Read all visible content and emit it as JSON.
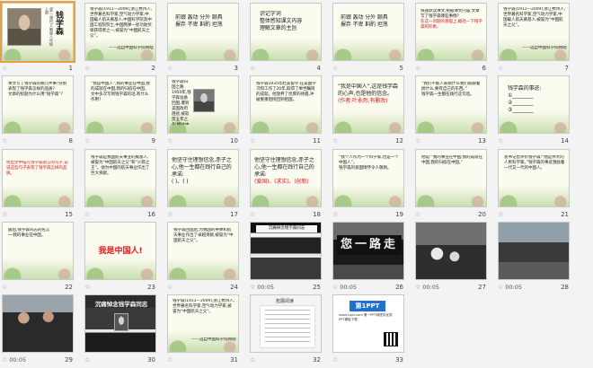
{
  "window": {
    "title": "Slide Sorter"
  },
  "slides": [
    {
      "num": "1",
      "kind": "title",
      "title": "钱学森",
      "subtitle": "(第一课时)人教版八年级上册",
      "star": "☆"
    },
    {
      "num": "2",
      "kind": "text",
      "lines": [
        "钱学森(1911—2009),浙江杭州人,世界著名科学家,空气动力学家,中国载人航天奠基人,中国科学院及中国工程院院士,中国两弹一星功勋奖章获得者之一,被誉为“中国航天之父”。"
      ],
      "footer": "——选自中国科学院网站",
      "star": "☆"
    },
    {
      "num": "3",
      "kind": "words",
      "lines": [
        "前辍  轰动  分外  颇具",
        "摒弃  不卑  斟酌  坦荡"
      ],
      "star": "☆"
    },
    {
      "num": "4",
      "kind": "text2",
      "lines": [
        "识记字词",
        "整体感知课文内容",
        "理解文章的主旨"
      ],
      "star": "☆"
    },
    {
      "num": "5",
      "kind": "words",
      "lines": [
        "前辍  轰动  分外  颇具",
        "摒弃  不卑  斟酌  坦荡"
      ],
      "star": "☆"
    },
    {
      "num": "6",
      "kind": "question",
      "lines": [
        "快速默读课文,把握课文内容,文章写了钱学森哪些事情?",
        "在这一问题的基础上,概括一下钱学森的形象。"
      ],
      "star": "☆"
    },
    {
      "num": "7",
      "kind": "text",
      "lines": [
        "钱学森(1911—2009),浙江杭州人,世界著名科学家,空气动力学家,中国载人航天奠基人,被誉为“中国航天之父”。"
      ],
      "footer": "——选自中国科学院网站",
      "star": "☆"
    },
    {
      "num": "8",
      "kind": "plain",
      "lines": [
        "本文写了钱学森的哪几件事?分别表现了钱学森怎样的品质?",
        "文章的标题为什么用“钱学森”?"
      ],
      "star": "☆"
    },
    {
      "num": "9",
      "kind": "plain",
      "lines": [
        "“我是中国人”,我的事业在中国,我的成就在中国,我的归宿在中国。",
        "文中多次写到钱学森的话,有什么作用?"
      ],
      "star": "☆"
    },
    {
      "num": "10",
      "kind": "portrait",
      "lines": [
        "钱学森归国之路",
        "1950年,钱学森准备回国,遭到美国政府阻挠,被软禁五年之久,经过中国政府的交涉,1955年终于回到祖国。"
      ],
      "star": "☆"
    },
    {
      "num": "11",
      "kind": "plain",
      "lines": [
        "钱学森1935年赴美留学,在美国学习和工作了20年,取得了举世瞩目的成就。他放弃了优厚的待遇,冲破重重阻挠回到祖国。"
      ],
      "star": "☆"
    },
    {
      "num": "12",
      "kind": "quote",
      "lines": [
        "“我是中国人”,这是钱学森的心声,也是他的信念。",
        "(作者:叶永烈,有删改)"
      ],
      "star": "☆"
    },
    {
      "num": "13",
      "kind": "plain",
      "lines": [
        "“我们不能人家搞什么我们就跟着搞什么,要有自己的东西。”",
        "钱学森一生都在践行这句话。"
      ],
      "star": "☆"
    },
    {
      "num": "14",
      "kind": "fill",
      "lines": [
        "钱学森的事迹:",
        "①________",
        "②________",
        "③________"
      ],
      "star": "☆"
    },
    {
      "num": "15",
      "kind": "redtext",
      "lines": [
        "找出文中描写钱学森语言的句子,说说这些句子表现了钱学森怎样的品质。"
      ],
      "star": "☆"
    },
    {
      "num": "16",
      "kind": "plain",
      "lines": [
        "钱学森是我国航天事业的奠基人,被誉为“中国航天之父”和“火箭之王”。他为中国的航天事业作出了巨大贡献。"
      ],
      "star": "☆"
    },
    {
      "num": "17",
      "kind": "fill2",
      "lines": [
        "他坚守住理想信念,赤子之心,他一生都在践行自己的承诺:",
        "(  )、(  )"
      ],
      "star": "☆"
    },
    {
      "num": "18",
      "kind": "fill3",
      "lines": [
        "他坚守住理想信念,赤子之心,他一生都在践行自己的承诺:",
        "(爱国)、(求实)、(创新)"
      ],
      "star": "☆"
    },
    {
      "num": "19",
      "kind": "plain",
      "lines": [
        "“我个人作为一个科学家,也是一个中国人”。",
        "钱学森的爱国情怀令人敬佩。"
      ],
      "star": "☆"
    },
    {
      "num": "20",
      "kind": "plain",
      "lines": [
        "他说:“我的事业在中国,我的成就在中国,我的归宿在中国。”"
      ],
      "star": "☆"
    },
    {
      "num": "21",
      "kind": "plain",
      "lines": [
        "总书记曾评价钱学森:“他是伟大的人民科学家。”钱学森的事迹激励着一代又一代的中国人。"
      ],
      "star": "☆"
    },
    {
      "num": "22",
      "kind": "plain",
      "lines": [
        "最后,钱学森同志的名言",
        "──我的事业在中国。"
      ],
      "star": "☆"
    },
    {
      "num": "23",
      "kind": "slogan",
      "lines": [
        "我是中国人!"
      ],
      "star": "☆"
    },
    {
      "num": "24",
      "kind": "plain",
      "lines": [
        "钱学森回国后,为我国的导弹和航天事业作出了卓越贡献,被誉为“中国航天之父”。"
      ],
      "star": "☆"
    },
    {
      "num": "25",
      "kind": "hall",
      "sign": "沉痛悼念钱学森同志",
      "time": "00:05",
      "star": "☆"
    },
    {
      "num": "26",
      "kind": "banner",
      "banner": "您一路走好",
      "time": "00:05",
      "star": "☆"
    },
    {
      "num": "27",
      "kind": "wreath",
      "time": "00:05",
      "star": "☆"
    },
    {
      "num": "28",
      "kind": "street",
      "time": "00:05",
      "star": "☆"
    },
    {
      "num": "29",
      "kind": "people",
      "time": "00:05",
      "star": "☆"
    },
    {
      "num": "30",
      "kind": "memorial",
      "sign": "沉痛悼念钱学森同志",
      "star": "☆"
    },
    {
      "num": "31",
      "kind": "text",
      "lines": [
        "钱学森(1911—2009),浙江杭州人,世界著名科学家,空气动力学家,被誉为“中国航天之父”。"
      ],
      "footer": "——选自中国科学院网站",
      "star": "☆"
    },
    {
      "num": "32",
      "kind": "book",
      "title": "拓展阅读",
      "star": "☆"
    },
    {
      "num": "33",
      "kind": "ppt",
      "logo": "第1PPT",
      "site": "www.1ppt.com 第一PPT网提供优质PPT模板下载",
      "star": "☆"
    }
  ]
}
